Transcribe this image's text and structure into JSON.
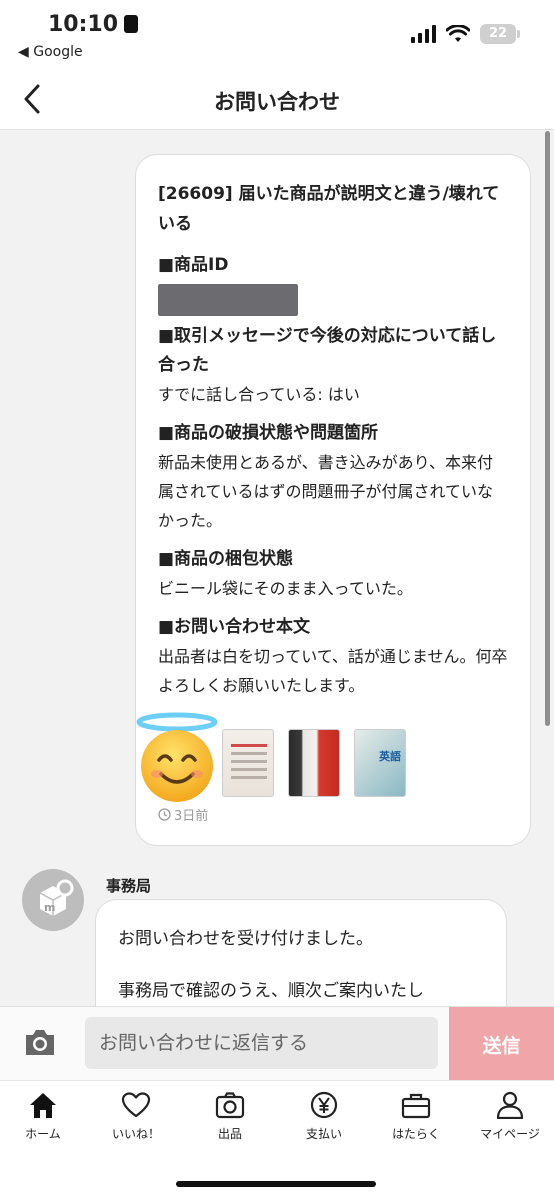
{
  "status_bar": {
    "time": "10:10",
    "back_app": "◀ Google",
    "battery": "22"
  },
  "header": {
    "title": "お問い合わせ"
  },
  "user_message": {
    "subject": "[26609] 届いた商品が説明文と違う/壊れている",
    "sections": [
      {
        "title": "■商品ID",
        "body": ""
      },
      {
        "title": "■取引メッセージで今後の対応について話し合った",
        "body": "すでに話し合っている: はい"
      },
      {
        "title": "■商品の破損状態や問題箇所",
        "body": "新品未使用とあるが、書き込みがあり、本来付属されているはずの問題冊子が付属されていなかった。"
      },
      {
        "title": "■商品の梱包状態",
        "body": "ビニール袋にそのまま入っていた。"
      },
      {
        "title": "■お問い合わせ本文",
        "body": "出品者は白を切っていて、話が通じません。何卒よろしくお願いいたします。"
      }
    ],
    "timestamp": "3日前"
  },
  "admin_message": {
    "sender": "事務局",
    "lines": [
      "お問い合わせを受け付けました。",
      "事務局で確認のうえ、順次ご案内いたし"
    ]
  },
  "reply_bar": {
    "placeholder": "お問い合わせに返信する",
    "send_label": "送信"
  },
  "tabbar": {
    "items": [
      {
        "label": "ホーム",
        "icon": "home-icon"
      },
      {
        "label": "いいね！",
        "icon": "heart-icon"
      },
      {
        "label": "出品",
        "icon": "camera-icon"
      },
      {
        "label": "支払い",
        "icon": "yen-icon"
      },
      {
        "label": "はたらく",
        "icon": "briefcase-icon"
      },
      {
        "label": "マイページ",
        "icon": "person-icon"
      }
    ]
  },
  "colors": {
    "send_button": "#f0a6a8",
    "background": "#f2f2f2"
  }
}
